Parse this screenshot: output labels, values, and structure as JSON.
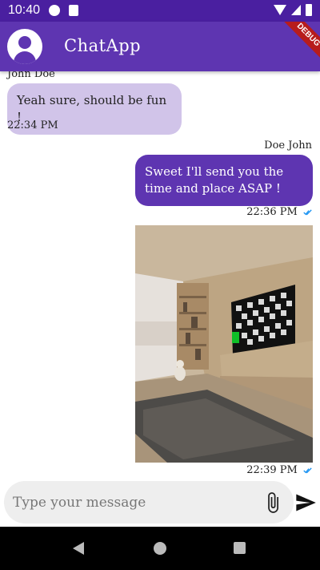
{
  "status_bar": {
    "time": "10:40",
    "icons": [
      "notification-icon",
      "sd-card-icon",
      "wifi-icon",
      "signal-icon",
      "battery-icon"
    ]
  },
  "app_bar": {
    "title": "ChatApp",
    "avatar_icon": "account-circle-icon",
    "debug_banner": "DEBUG"
  },
  "messages": [
    {
      "direction": "incoming",
      "sender": "John Doe",
      "text": "Yeah sure, should be fun !",
      "time": "22:34 PM"
    },
    {
      "direction": "outgoing",
      "sender": "Doe John",
      "text": "Sweet I'll send you the time and place ASAP !",
      "time": "22:36 PM",
      "status_icon": "double-check-icon"
    },
    {
      "direction": "outgoing",
      "type": "image",
      "image_description": "rendered room with wooden floor, bookshelf, cat and TV showing checkerboard",
      "time": "22:39 PM",
      "status_icon": "double-check-icon"
    }
  ],
  "composer": {
    "placeholder": "Type your message",
    "attach_icon": "paperclip-icon",
    "send_icon": "send-icon"
  },
  "nav_bar": {
    "buttons": [
      "back-icon",
      "home-icon",
      "recents-icon"
    ]
  },
  "colors": {
    "status_bar": "#4a1fa0",
    "primary": "#5e35b1",
    "incoming_bubble": "#d1c4e9",
    "check": "#2196f3"
  }
}
